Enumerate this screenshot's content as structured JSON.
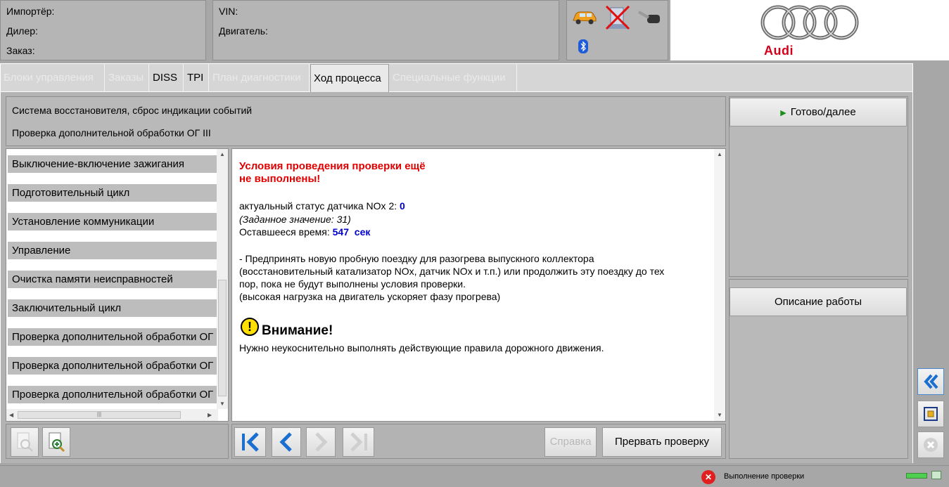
{
  "header": {
    "importer_label": "Импортёр:",
    "dealer_label": "Дилер:",
    "order_label": "Заказ:",
    "vin_label": "VIN:",
    "engine_label": "Двигатель:",
    "brand": "Audi",
    "icons": [
      "car-icon",
      "network-disconnected-icon",
      "key-icon",
      "bluetooth-icon"
    ]
  },
  "tabs": [
    {
      "label": "Блоки управления",
      "state": "disabled"
    },
    {
      "label": "Заказы",
      "state": "disabled"
    },
    {
      "label": "DISS",
      "state": "enabled"
    },
    {
      "label": "TPI",
      "state": "enabled"
    },
    {
      "label": "План диагностики",
      "state": "disabled"
    },
    {
      "label": "Ход процесса",
      "state": "active"
    },
    {
      "label": "Специальные функции",
      "state": "disabled"
    }
  ],
  "title": {
    "line1": "Система восстановителя, сброс индикации событий",
    "line2": "Проверка дополнительной обработки ОГ III"
  },
  "steps": [
    "Выключение-включение зажигания",
    "Подготовительный цикл",
    "Установление коммуникации",
    "Управление",
    "Очистка памяти неисправностей",
    "Заключительный цикл",
    "Проверка дополнительной обработки ОГ III",
    "Проверка дополнительной обработки ОГ III",
    "Проверка дополнительной обработки ОГ III"
  ],
  "content": {
    "heading_line1": "Условия проведения проверки ещё",
    "heading_line2": "не выполнены!",
    "status_label": "актуальный статус датчика NOx 2: ",
    "status_value": "0",
    "setpoint": "(Заданное значение: 31)",
    "remaining_label": "Оставшееся время: ",
    "remaining_value": "547  сек",
    "instr_1": "- Предпринять новую пробную поездку для разогрева выпускного коллектора",
    "instr_2": "(восстановительный катализатор NOx, датчик NOx и т.п.) или продолжить эту поездку до тех",
    "instr_3": "пор, пока не будут выполнены условия проверки.",
    "instr_4": "(высокая нагрузка на двигатель ускоряет фазу прогрева)",
    "warning_title": "Внимание!",
    "warning_text": "Нужно неукоснительно выполнять действующие правила дорожного движения."
  },
  "right": {
    "next_button": "Готово/далее",
    "description_button": "Описание работы"
  },
  "toolbar": {
    "help_button": "Справка",
    "abort_button": "Прервать проверку"
  },
  "status": {
    "text": "Выполнение проверки"
  },
  "colors": {
    "warning_red": "#e00000",
    "value_blue": "#0000d0",
    "nav_blue": "#1a6fd0"
  }
}
